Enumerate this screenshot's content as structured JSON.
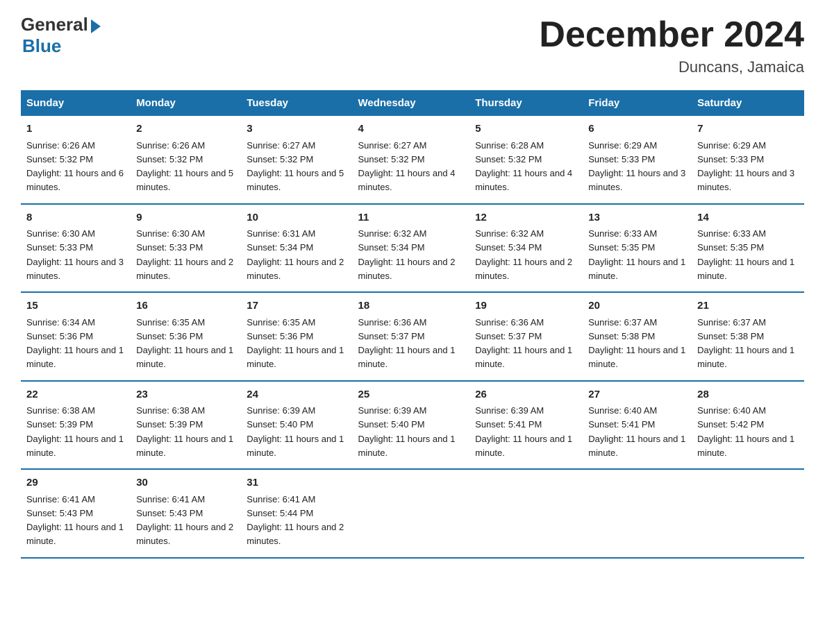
{
  "logo": {
    "general": "General",
    "blue": "Blue"
  },
  "header": {
    "title": "December 2024",
    "subtitle": "Duncans, Jamaica"
  },
  "columns": [
    "Sunday",
    "Monday",
    "Tuesday",
    "Wednesday",
    "Thursday",
    "Friday",
    "Saturday"
  ],
  "weeks": [
    [
      {
        "day": "1",
        "sunrise": "6:26 AM",
        "sunset": "5:32 PM",
        "daylight": "11 hours and 6 minutes."
      },
      {
        "day": "2",
        "sunrise": "6:26 AM",
        "sunset": "5:32 PM",
        "daylight": "11 hours and 5 minutes."
      },
      {
        "day": "3",
        "sunrise": "6:27 AM",
        "sunset": "5:32 PM",
        "daylight": "11 hours and 5 minutes."
      },
      {
        "day": "4",
        "sunrise": "6:27 AM",
        "sunset": "5:32 PM",
        "daylight": "11 hours and 4 minutes."
      },
      {
        "day": "5",
        "sunrise": "6:28 AM",
        "sunset": "5:32 PM",
        "daylight": "11 hours and 4 minutes."
      },
      {
        "day": "6",
        "sunrise": "6:29 AM",
        "sunset": "5:33 PM",
        "daylight": "11 hours and 3 minutes."
      },
      {
        "day": "7",
        "sunrise": "6:29 AM",
        "sunset": "5:33 PM",
        "daylight": "11 hours and 3 minutes."
      }
    ],
    [
      {
        "day": "8",
        "sunrise": "6:30 AM",
        "sunset": "5:33 PM",
        "daylight": "11 hours and 3 minutes."
      },
      {
        "day": "9",
        "sunrise": "6:30 AM",
        "sunset": "5:33 PM",
        "daylight": "11 hours and 2 minutes."
      },
      {
        "day": "10",
        "sunrise": "6:31 AM",
        "sunset": "5:34 PM",
        "daylight": "11 hours and 2 minutes."
      },
      {
        "day": "11",
        "sunrise": "6:32 AM",
        "sunset": "5:34 PM",
        "daylight": "11 hours and 2 minutes."
      },
      {
        "day": "12",
        "sunrise": "6:32 AM",
        "sunset": "5:34 PM",
        "daylight": "11 hours and 2 minutes."
      },
      {
        "day": "13",
        "sunrise": "6:33 AM",
        "sunset": "5:35 PM",
        "daylight": "11 hours and 1 minute."
      },
      {
        "day": "14",
        "sunrise": "6:33 AM",
        "sunset": "5:35 PM",
        "daylight": "11 hours and 1 minute."
      }
    ],
    [
      {
        "day": "15",
        "sunrise": "6:34 AM",
        "sunset": "5:36 PM",
        "daylight": "11 hours and 1 minute."
      },
      {
        "day": "16",
        "sunrise": "6:35 AM",
        "sunset": "5:36 PM",
        "daylight": "11 hours and 1 minute."
      },
      {
        "day": "17",
        "sunrise": "6:35 AM",
        "sunset": "5:36 PM",
        "daylight": "11 hours and 1 minute."
      },
      {
        "day": "18",
        "sunrise": "6:36 AM",
        "sunset": "5:37 PM",
        "daylight": "11 hours and 1 minute."
      },
      {
        "day": "19",
        "sunrise": "6:36 AM",
        "sunset": "5:37 PM",
        "daylight": "11 hours and 1 minute."
      },
      {
        "day": "20",
        "sunrise": "6:37 AM",
        "sunset": "5:38 PM",
        "daylight": "11 hours and 1 minute."
      },
      {
        "day": "21",
        "sunrise": "6:37 AM",
        "sunset": "5:38 PM",
        "daylight": "11 hours and 1 minute."
      }
    ],
    [
      {
        "day": "22",
        "sunrise": "6:38 AM",
        "sunset": "5:39 PM",
        "daylight": "11 hours and 1 minute."
      },
      {
        "day": "23",
        "sunrise": "6:38 AM",
        "sunset": "5:39 PM",
        "daylight": "11 hours and 1 minute."
      },
      {
        "day": "24",
        "sunrise": "6:39 AM",
        "sunset": "5:40 PM",
        "daylight": "11 hours and 1 minute."
      },
      {
        "day": "25",
        "sunrise": "6:39 AM",
        "sunset": "5:40 PM",
        "daylight": "11 hours and 1 minute."
      },
      {
        "day": "26",
        "sunrise": "6:39 AM",
        "sunset": "5:41 PM",
        "daylight": "11 hours and 1 minute."
      },
      {
        "day": "27",
        "sunrise": "6:40 AM",
        "sunset": "5:41 PM",
        "daylight": "11 hours and 1 minute."
      },
      {
        "day": "28",
        "sunrise": "6:40 AM",
        "sunset": "5:42 PM",
        "daylight": "11 hours and 1 minute."
      }
    ],
    [
      {
        "day": "29",
        "sunrise": "6:41 AM",
        "sunset": "5:43 PM",
        "daylight": "11 hours and 1 minute."
      },
      {
        "day": "30",
        "sunrise": "6:41 AM",
        "sunset": "5:43 PM",
        "daylight": "11 hours and 2 minutes."
      },
      {
        "day": "31",
        "sunrise": "6:41 AM",
        "sunset": "5:44 PM",
        "daylight": "11 hours and 2 minutes."
      },
      null,
      null,
      null,
      null
    ]
  ]
}
